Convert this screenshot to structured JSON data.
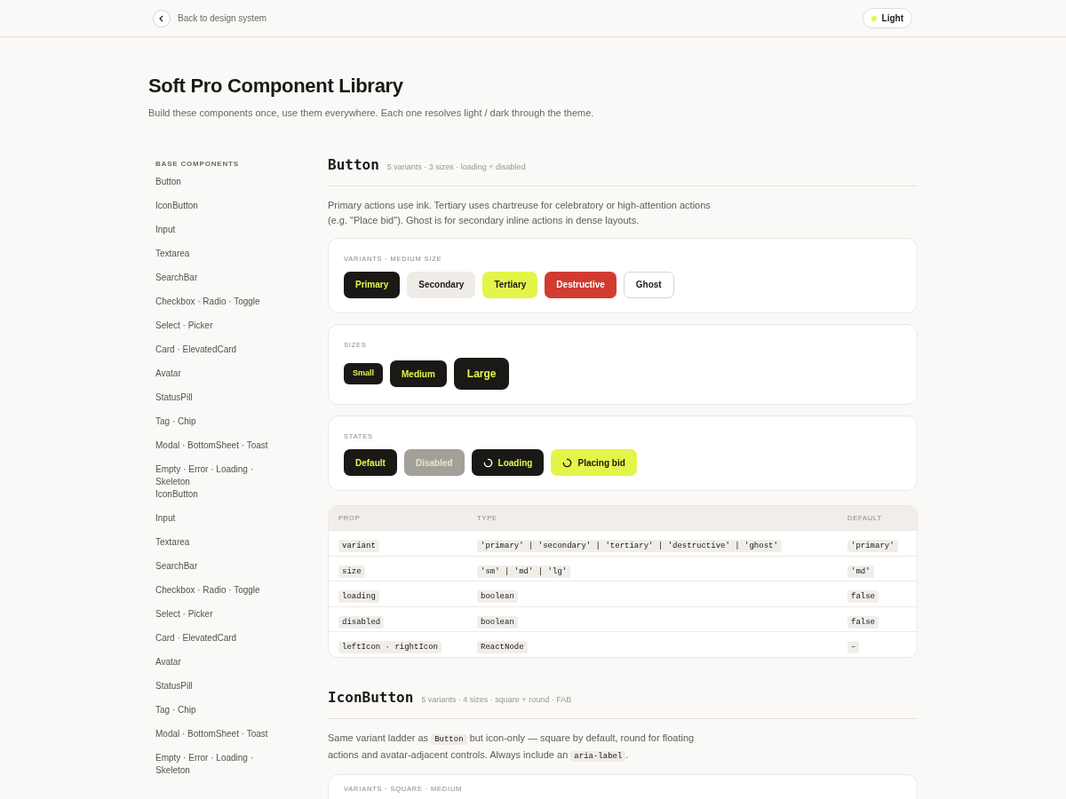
{
  "header": {
    "back_label": "Back to design system",
    "theme_toggle": "Light"
  },
  "page": {
    "title": "Soft Pro Component Library",
    "subtitle": "Build these components once, use them everywhere. Each one resolves light / dark through the theme."
  },
  "sidebar": {
    "heading": "BASE COMPONENTS",
    "items": [
      "Button",
      "IconButton",
      "Input",
      "Textarea",
      "SearchBar",
      "Checkbox · Radio · Toggle",
      "Select · Picker",
      "Card · ElevatedCard",
      "Avatar",
      "StatusPill",
      "Tag · Chip",
      "Modal · BottomSheet · Toast",
      "Empty · Error · Loading · Skeleton",
      "IconButton",
      "Input",
      "Textarea",
      "SearchBar",
      "Checkbox · Radio · Toggle",
      "Select · Picker",
      "Card · ElevatedCard",
      "Avatar",
      "StatusPill",
      "Tag · Chip",
      "Modal · BottomSheet · Toast",
      "Empty · Error · Loading · Skeleton"
    ]
  },
  "sections": [
    {
      "title": "Button",
      "meta": "5 variants · 3 sizes · loading + disabled",
      "description": [
        {
          "kind": "text",
          "text": "Primary actions use ink. Tertiary uses chartreuse for celebratory or high-attention actions (e.g. \"Place bid\"). Ghost is for secondary inline actions in dense layouts."
        }
      ],
      "demos": [
        {
          "label": "VARIANTS · MEDIUM SIZE",
          "buttons": [
            {
              "label": "Primary",
              "kind": "primary"
            },
            {
              "label": "Secondary",
              "kind": "secondary"
            },
            {
              "label": "Tertiary",
              "kind": "tertiary"
            },
            {
              "label": "Destructive",
              "kind": "destructive"
            },
            {
              "label": "Ghost",
              "kind": "ghost"
            }
          ]
        },
        {
          "label": "SIZES",
          "buttons": [
            {
              "label": "Small",
              "kind": "small"
            },
            {
              "label": "Medium",
              "kind": "primary"
            },
            {
              "label": "Large",
              "kind": "large"
            }
          ]
        },
        {
          "label": "STATES",
          "buttons": [
            {
              "label": "Default",
              "kind": "primary"
            },
            {
              "label": "Disabled",
              "kind": "disabled"
            },
            {
              "label": "Loading",
              "kind": "loading"
            },
            {
              "label": "Placing bid",
              "kind": "bidding"
            }
          ]
        }
      ],
      "props_table": {
        "columns": [
          "PROP",
          "TYPE",
          "DEFAULT"
        ],
        "rows": [
          [
            "variant",
            "'primary' | 'secondary' | 'tertiary' | 'destructive' | 'ghost'",
            "'primary'"
          ],
          [
            "size",
            "'sm' | 'md' | 'lg'",
            "'md'"
          ],
          [
            "loading",
            "boolean",
            "false"
          ],
          [
            "disabled",
            "boolean",
            "false"
          ],
          [
            "leftIcon · rightIcon",
            "ReactNode",
            "–"
          ]
        ]
      }
    },
    {
      "title": "IconButton",
      "meta": "5 variants · 4 sizes · square + round · FAB",
      "description": [
        {
          "kind": "text",
          "text": "Same variant ladder as "
        },
        {
          "kind": "code",
          "text": "Button"
        },
        {
          "kind": "text",
          "text": " but icon-only — square by default, round for floating actions and avatar-adjacent controls. Always include an "
        },
        {
          "kind": "code",
          "text": "aria-label"
        },
        {
          "kind": "text",
          "text": "."
        }
      ],
      "demos": [
        {
          "label": "VARIANTS · SQUARE · MEDIUM"
        }
      ]
    }
  ]
}
